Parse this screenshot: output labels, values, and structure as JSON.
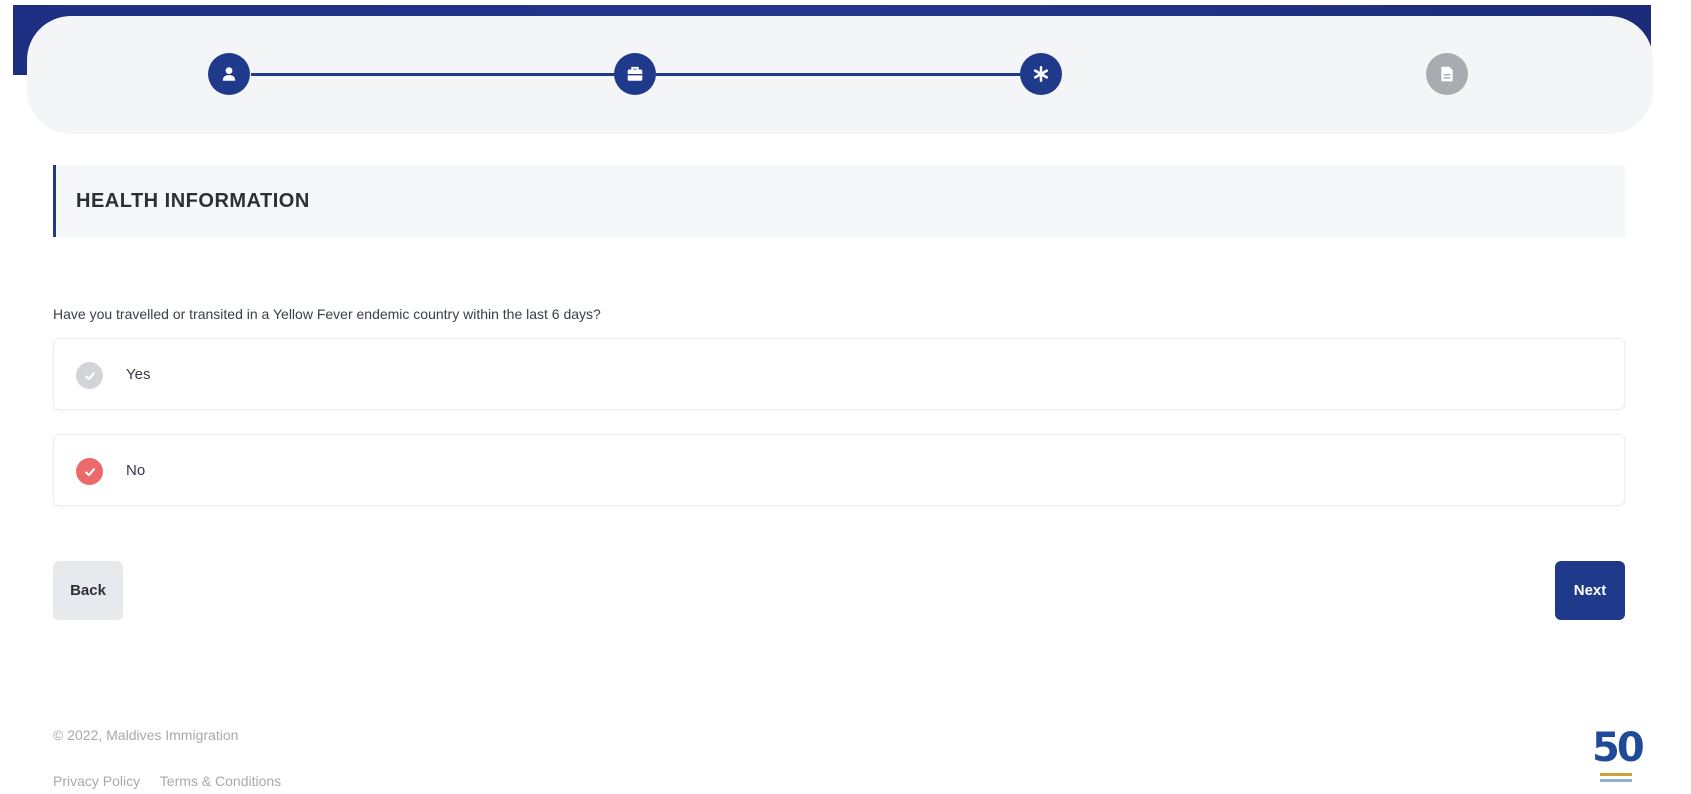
{
  "stepper": {
    "steps": [
      {
        "icon": "user-icon",
        "state": "completed"
      },
      {
        "icon": "briefcase-icon",
        "state": "completed"
      },
      {
        "icon": "asterisk-icon",
        "state": "active"
      },
      {
        "icon": "document-icon",
        "state": "inactive"
      }
    ]
  },
  "section": {
    "title": "HEALTH INFORMATION"
  },
  "form": {
    "question": "Have you travelled or transited in a Yellow Fever endemic country within the last 6 days?",
    "options": [
      {
        "label": "Yes",
        "selected": false
      },
      {
        "label": "No",
        "selected": true
      }
    ]
  },
  "actions": {
    "back_label": "Back",
    "next_label": "Next"
  },
  "footer": {
    "copyright": "© 2022, Maldives Immigration",
    "privacy_label": "Privacy Policy",
    "terms_label": "Terms & Conditions",
    "logo_text": "50"
  },
  "colors": {
    "primary": "#1f3a8a",
    "selected": "#ec6a6a",
    "inactive": "#a9abb0"
  }
}
